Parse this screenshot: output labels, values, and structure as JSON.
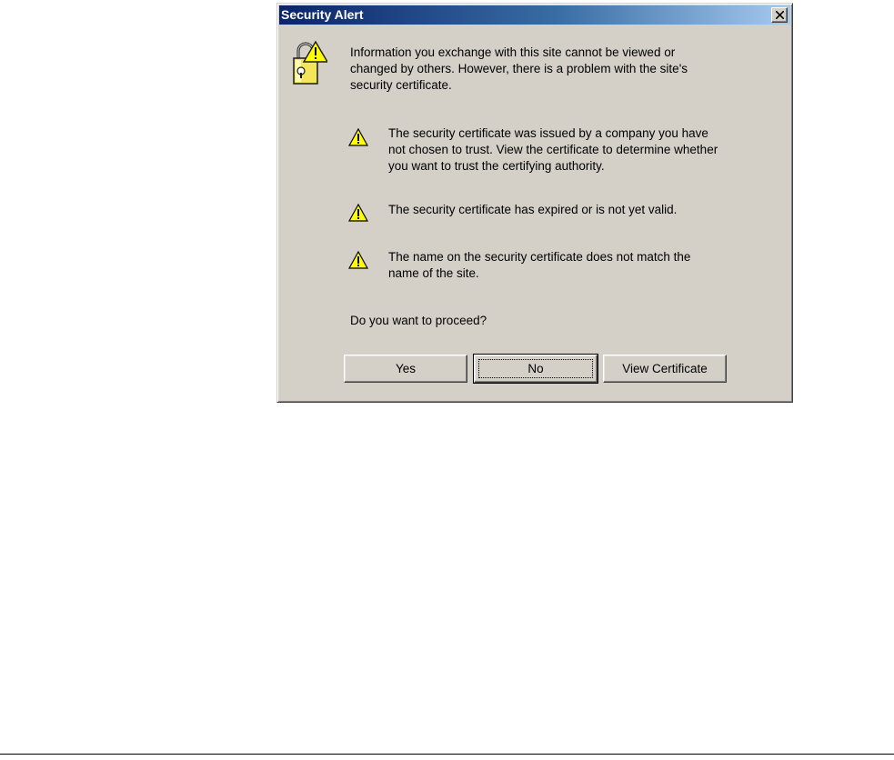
{
  "dialog": {
    "title": "Security Alert",
    "close_glyph": "×",
    "intro": "Information you exchange with this site cannot be viewed or\nchanged by others. However, there is a problem with the site's\nsecurity certificate.",
    "warnings": [
      "The security certificate was issued by a company you have\nnot chosen to trust. View the certificate to determine whether\nyou want to trust the certifying authority.",
      "The security certificate has expired or is not yet valid.",
      "The name on the security certificate does not match the\nname of the site."
    ],
    "question": "Do you want to proceed?",
    "buttons": {
      "yes": "Yes",
      "no": "No",
      "view_certificate": "View Certificate"
    },
    "icons": {
      "main": "lock-warning-icon",
      "warning": "warning-triangle-icon"
    },
    "colors": {
      "titlebar_start": "#0a246a",
      "titlebar_end": "#a6caf0",
      "face": "#d4d0c8",
      "warning_yellow": "#ffff00"
    }
  }
}
